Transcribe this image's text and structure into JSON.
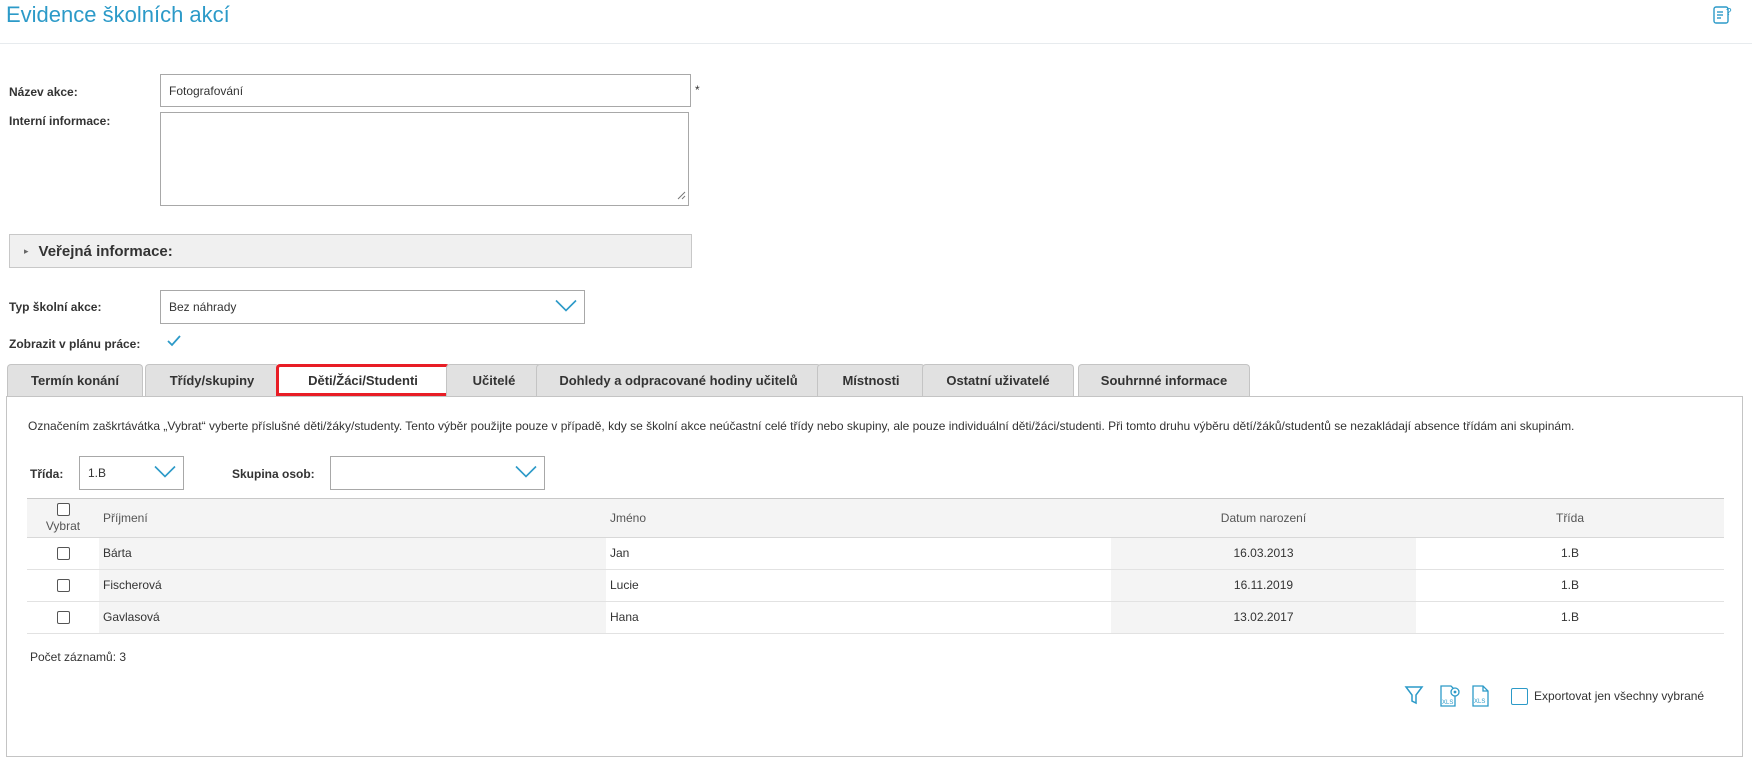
{
  "page": {
    "title": "Evidence školních akcí"
  },
  "icons": {
    "help": "help-document-icon",
    "accent": "#2c9ac8",
    "active_tab_border": "#e81d25"
  },
  "form": {
    "name_label": "Název akce:",
    "name_value": "Fotografování",
    "required_mark": "*",
    "internal_label": "Interní informace:",
    "internal_value": "",
    "public_section_label": "Veřejná informace:",
    "type_label": "Typ školní akce:",
    "type_value": "Bez náhrady",
    "show_in_plan_label": "Zobrazit v plánu práce:",
    "show_in_plan_checked": true
  },
  "tabs": [
    {
      "label": "Termín konání",
      "active": false
    },
    {
      "label": "Třídy/skupiny",
      "active": false
    },
    {
      "label": "Děti/Žáci/Studenti",
      "active": true
    },
    {
      "label": "Učitelé",
      "active": false
    },
    {
      "label": "Dohledy a odpracované hodiny učitelů",
      "active": false
    },
    {
      "label": "Místnosti",
      "active": false
    },
    {
      "label": "Ostatní uživatelé",
      "active": false
    },
    {
      "label": "Souhrnné informace",
      "active": false
    }
  ],
  "students_tab": {
    "info": "Označením zaškrtávátka „Vybrat“ vyberte příslušné děti/žáky/studenty. Tento výběr použijte pouze v případě, kdy se školní akce neúčastní celé třídy nebo skupiny, ale pouze individuální děti/žáci/studenti. Při tomto druhu výběru dětí/žáků/studentů se nezakládají absence třídám ani skupinám.",
    "class_label": "Třída:",
    "class_value": "1.B",
    "group_label": "Skupina osob:",
    "group_value": "",
    "columns": {
      "select": "Vybrat",
      "last_name": "Příjmení",
      "first_name": "Jméno",
      "birth_date": "Datum narození",
      "class": "Třída"
    },
    "rows": [
      {
        "last_name": "Bárta",
        "first_name": "Jan",
        "birth_date": "16.03.2013",
        "class": "1.B",
        "selected": false
      },
      {
        "last_name": "Fischerová",
        "first_name": "Lucie",
        "birth_date": "16.11.2019",
        "class": "1.B",
        "selected": false
      },
      {
        "last_name": "Gavlasová",
        "first_name": "Hana",
        "birth_date": "13.02.2017",
        "class": "1.B",
        "selected": false
      }
    ],
    "record_count": "Počet záznamů: 3",
    "tools": [
      "filter-icon",
      "xls-settings-icon",
      "xls-export-icon"
    ],
    "export_only_selected_label": "Exportovat jen všechny vybrané",
    "export_only_selected_checked": false
  }
}
